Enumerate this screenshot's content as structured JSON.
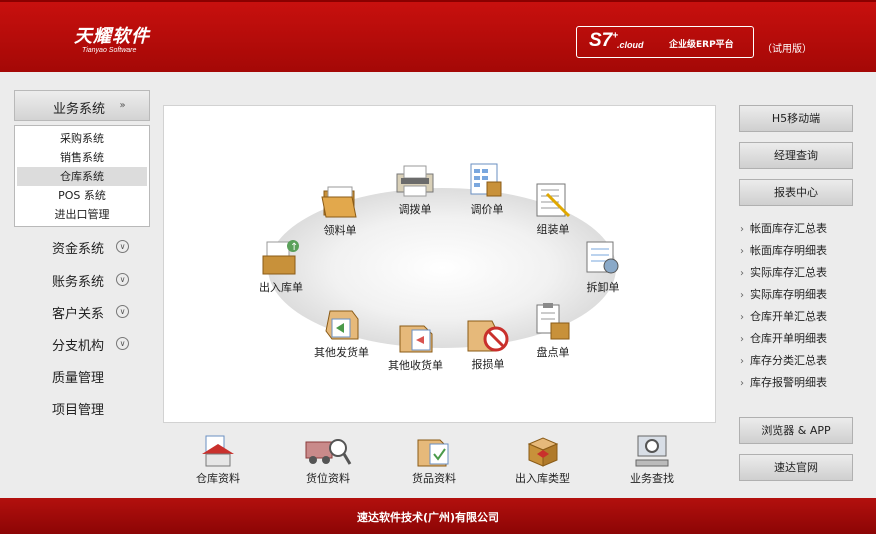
{
  "header": {
    "logo_cn": "天耀软件",
    "logo_en": "Tianyao Software",
    "product_main": "S7",
    "product_super": "+",
    "product_sub": ".cloud",
    "platform": "企业级ERP平台",
    "edition": "（试用版）"
  },
  "sidebar": {
    "head_label": "业务系统",
    "sub_items": [
      "采购系统",
      "销售系统",
      "仓库系统",
      "POS 系统",
      "进出口管理"
    ],
    "active_sub": "仓库系统",
    "items": [
      "资金系统",
      "账务系统",
      "客户关系",
      "分支机构",
      "质量管理",
      "项目管理"
    ]
  },
  "main": {
    "items": [
      "领料单",
      "调拨单",
      "调价单",
      "组装单",
      "出入库单",
      "拆卸单",
      "其他发货单",
      "其他收货单",
      "报损单",
      "盘点单"
    ]
  },
  "bottom": {
    "items": [
      "仓库资料",
      "货位资料",
      "货品资料",
      "出入库类型",
      "业务查找"
    ]
  },
  "right": {
    "h5": "H5移动端",
    "manager": "经理查询",
    "report_center": "报表中心",
    "reports": [
      "帐面库存汇总表",
      "帐面库存明细表",
      "实际库存汇总表",
      "实际库存明细表",
      "仓库开单汇总表",
      "仓库开单明细表",
      "库存分类汇总表",
      "库存报警明细表"
    ],
    "browser_app": "浏览器 & APP",
    "website": "速达官网"
  },
  "footer": {
    "company": "速达软件技术(广州)有限公司"
  },
  "colors": {
    "brand_red": "#b00c0a",
    "panel_bg": "#ececec"
  }
}
